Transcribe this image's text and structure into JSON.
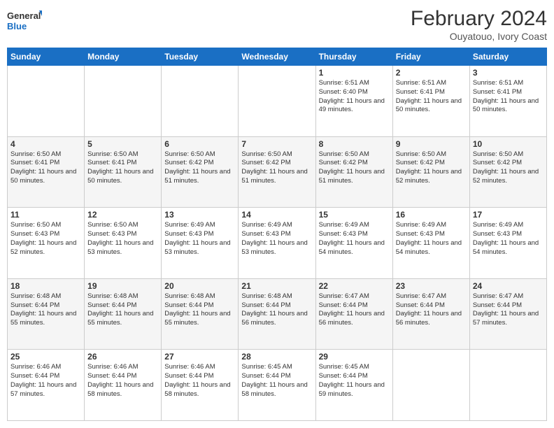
{
  "header": {
    "logo_general": "General",
    "logo_blue": "Blue",
    "title": "February 2024",
    "subtitle": "Ouyatouo, Ivory Coast"
  },
  "days_of_week": [
    "Sunday",
    "Monday",
    "Tuesday",
    "Wednesday",
    "Thursday",
    "Friday",
    "Saturday"
  ],
  "weeks": [
    [
      {
        "day": "",
        "info": ""
      },
      {
        "day": "",
        "info": ""
      },
      {
        "day": "",
        "info": ""
      },
      {
        "day": "",
        "info": ""
      },
      {
        "day": "1",
        "info": "Sunrise: 6:51 AM\nSunset: 6:40 PM\nDaylight: 11 hours and 49 minutes."
      },
      {
        "day": "2",
        "info": "Sunrise: 6:51 AM\nSunset: 6:41 PM\nDaylight: 11 hours and 50 minutes."
      },
      {
        "day": "3",
        "info": "Sunrise: 6:51 AM\nSunset: 6:41 PM\nDaylight: 11 hours and 50 minutes."
      }
    ],
    [
      {
        "day": "4",
        "info": "Sunrise: 6:50 AM\nSunset: 6:41 PM\nDaylight: 11 hours and 50 minutes."
      },
      {
        "day": "5",
        "info": "Sunrise: 6:50 AM\nSunset: 6:41 PM\nDaylight: 11 hours and 50 minutes."
      },
      {
        "day": "6",
        "info": "Sunrise: 6:50 AM\nSunset: 6:42 PM\nDaylight: 11 hours and 51 minutes."
      },
      {
        "day": "7",
        "info": "Sunrise: 6:50 AM\nSunset: 6:42 PM\nDaylight: 11 hours and 51 minutes."
      },
      {
        "day": "8",
        "info": "Sunrise: 6:50 AM\nSunset: 6:42 PM\nDaylight: 11 hours and 51 minutes."
      },
      {
        "day": "9",
        "info": "Sunrise: 6:50 AM\nSunset: 6:42 PM\nDaylight: 11 hours and 52 minutes."
      },
      {
        "day": "10",
        "info": "Sunrise: 6:50 AM\nSunset: 6:42 PM\nDaylight: 11 hours and 52 minutes."
      }
    ],
    [
      {
        "day": "11",
        "info": "Sunrise: 6:50 AM\nSunset: 6:43 PM\nDaylight: 11 hours and 52 minutes."
      },
      {
        "day": "12",
        "info": "Sunrise: 6:50 AM\nSunset: 6:43 PM\nDaylight: 11 hours and 53 minutes."
      },
      {
        "day": "13",
        "info": "Sunrise: 6:49 AM\nSunset: 6:43 PM\nDaylight: 11 hours and 53 minutes."
      },
      {
        "day": "14",
        "info": "Sunrise: 6:49 AM\nSunset: 6:43 PM\nDaylight: 11 hours and 53 minutes."
      },
      {
        "day": "15",
        "info": "Sunrise: 6:49 AM\nSunset: 6:43 PM\nDaylight: 11 hours and 54 minutes."
      },
      {
        "day": "16",
        "info": "Sunrise: 6:49 AM\nSunset: 6:43 PM\nDaylight: 11 hours and 54 minutes."
      },
      {
        "day": "17",
        "info": "Sunrise: 6:49 AM\nSunset: 6:43 PM\nDaylight: 11 hours and 54 minutes."
      }
    ],
    [
      {
        "day": "18",
        "info": "Sunrise: 6:48 AM\nSunset: 6:44 PM\nDaylight: 11 hours and 55 minutes."
      },
      {
        "day": "19",
        "info": "Sunrise: 6:48 AM\nSunset: 6:44 PM\nDaylight: 11 hours and 55 minutes."
      },
      {
        "day": "20",
        "info": "Sunrise: 6:48 AM\nSunset: 6:44 PM\nDaylight: 11 hours and 55 minutes."
      },
      {
        "day": "21",
        "info": "Sunrise: 6:48 AM\nSunset: 6:44 PM\nDaylight: 11 hours and 56 minutes."
      },
      {
        "day": "22",
        "info": "Sunrise: 6:47 AM\nSunset: 6:44 PM\nDaylight: 11 hours and 56 minutes."
      },
      {
        "day": "23",
        "info": "Sunrise: 6:47 AM\nSunset: 6:44 PM\nDaylight: 11 hours and 56 minutes."
      },
      {
        "day": "24",
        "info": "Sunrise: 6:47 AM\nSunset: 6:44 PM\nDaylight: 11 hours and 57 minutes."
      }
    ],
    [
      {
        "day": "25",
        "info": "Sunrise: 6:46 AM\nSunset: 6:44 PM\nDaylight: 11 hours and 57 minutes."
      },
      {
        "day": "26",
        "info": "Sunrise: 6:46 AM\nSunset: 6:44 PM\nDaylight: 11 hours and 58 minutes."
      },
      {
        "day": "27",
        "info": "Sunrise: 6:46 AM\nSunset: 6:44 PM\nDaylight: 11 hours and 58 minutes."
      },
      {
        "day": "28",
        "info": "Sunrise: 6:45 AM\nSunset: 6:44 PM\nDaylight: 11 hours and 58 minutes."
      },
      {
        "day": "29",
        "info": "Sunrise: 6:45 AM\nSunset: 6:44 PM\nDaylight: 11 hours and 59 minutes."
      },
      {
        "day": "",
        "info": ""
      },
      {
        "day": "",
        "info": ""
      }
    ]
  ]
}
